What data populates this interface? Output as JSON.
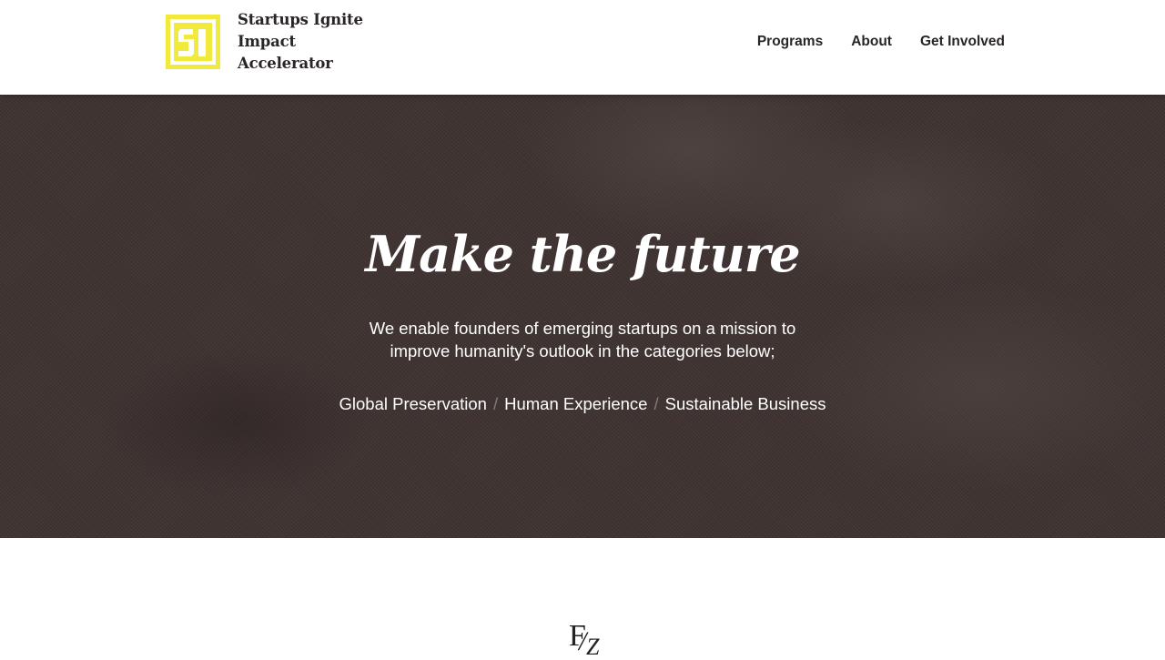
{
  "header": {
    "brand": {
      "logo_text": "SI",
      "logo_color": "#f2e93d",
      "name_line1": "Startups Ignite",
      "name_line2": "Impact Accelerator"
    },
    "nav": [
      {
        "label": "Programs"
      },
      {
        "label": "About"
      },
      {
        "label": "Get Involved"
      }
    ]
  },
  "hero": {
    "title": "Make the future",
    "description": "We enable founders of emerging startups on a mission to improve humanity's outlook in the categories below;",
    "categories": [
      {
        "label": "Global Preservation"
      },
      {
        "label": "Human Experience"
      },
      {
        "label": "Sustainable Business"
      }
    ],
    "separator": "/",
    "background_color": "#3f3332"
  },
  "footer_mark": {
    "letter_1": "F",
    "slash": "/",
    "letter_2": "Z"
  }
}
